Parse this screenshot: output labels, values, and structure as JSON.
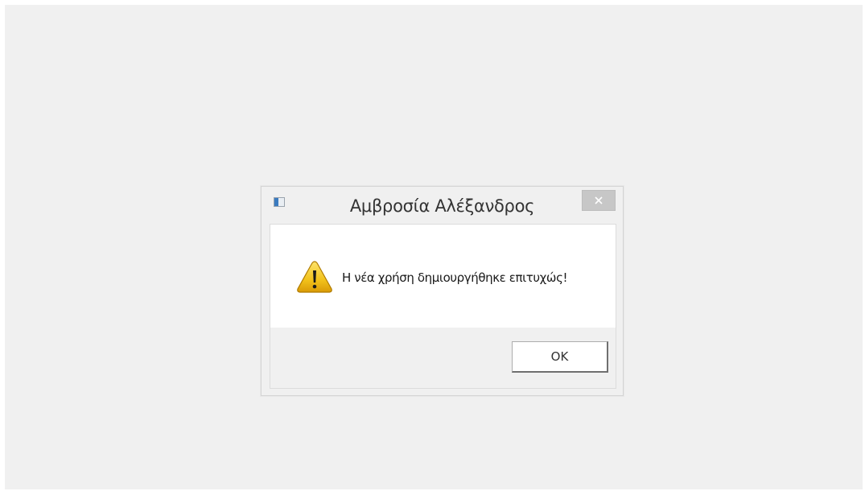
{
  "dialog": {
    "title": "Αμβροσία Αλέξανδρος",
    "message": "Η νέα χρήση δημιουργήθηκε επιτυχώς!",
    "ok_label": "OK",
    "icon": "warning-icon",
    "app_icon": "window-app-icon",
    "close_icon": "close-icon"
  },
  "colors": {
    "background": "#f0f0f0",
    "content_background": "#ffffff",
    "close_button": "#c7c7c7",
    "warning_yellow": "#f2c21b"
  }
}
